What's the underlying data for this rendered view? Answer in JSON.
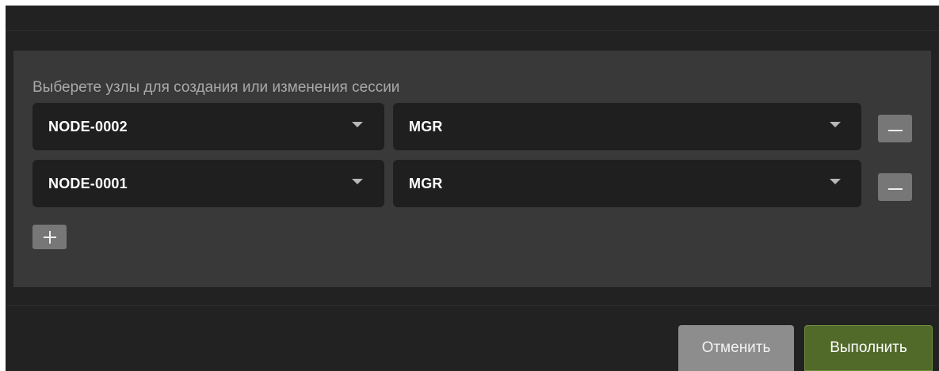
{
  "dialog": {
    "label": "Выберете узлы для создания или изменения сессии",
    "rows": [
      {
        "node": "NODE-0002",
        "role": "MGR"
      },
      {
        "node": "NODE-0001",
        "role": "MGR"
      }
    ],
    "add_label": "+",
    "remove_label": "−"
  },
  "footer": {
    "cancel_label": "Отменить",
    "submit_label": "Выполнить"
  },
  "colors": {
    "dialog_background": "#222222",
    "panel_background": "#393939",
    "select_background": "#1f1f1f",
    "icon_button": "#777777",
    "cancel_button": "#8d8d8d",
    "submit_button": "#516a2a"
  }
}
